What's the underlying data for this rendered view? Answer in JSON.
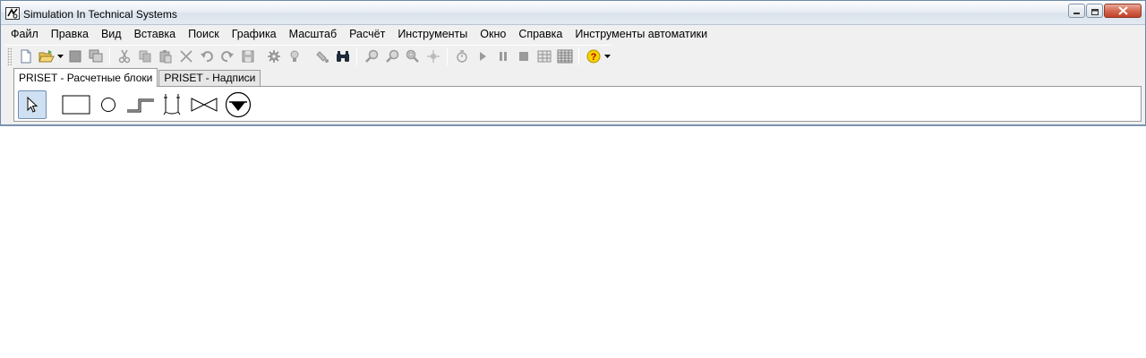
{
  "window": {
    "title": "Simulation In Technical Systems"
  },
  "menu": {
    "items": [
      {
        "label": "Файл"
      },
      {
        "label": "Правка"
      },
      {
        "label": "Вид"
      },
      {
        "label": "Вставка"
      },
      {
        "label": "Поиск"
      },
      {
        "label": "Графика"
      },
      {
        "label": "Масштаб"
      },
      {
        "label": "Расчёт"
      },
      {
        "label": "Инструменты"
      },
      {
        "label": "Окно"
      },
      {
        "label": "Справка"
      },
      {
        "label": "Инструменты автоматики"
      }
    ]
  },
  "toolbar": {
    "icons": [
      "new-file-icon",
      "open-folder-icon",
      "dropdown-arrow-icon",
      "stop-square-icon",
      "windows-icon",
      "cut-icon",
      "copy-icon",
      "paste-icon",
      "delete-icon",
      "undo-icon",
      "redo-icon",
      "save-icon",
      "gear-icon",
      "bulb-icon",
      "paint-icon",
      "binoculars-icon",
      "zoom-in-icon",
      "zoom-out-icon",
      "zoom-fit-icon",
      "crosshair-icon",
      "stopwatch-icon",
      "play-icon",
      "pause-icon",
      "stop-icon",
      "table-icon",
      "grid-icon",
      "help-icon",
      "dropdown-arrow-icon"
    ]
  },
  "tabs": [
    {
      "label": "PRISET - Расчетные блоки",
      "active": true
    },
    {
      "label": "PRISET - Надписи",
      "active": false
    }
  ],
  "palette": {
    "items": [
      "pointer-icon",
      "rectangle-block-icon",
      "circle-node-icon",
      "pipe-step-icon",
      "tank-icon",
      "valve-icon",
      "pump-icon"
    ],
    "selected": "pointer-icon"
  },
  "colors": {
    "window_border": "#6f8aa8",
    "close_button": "#c2402a",
    "selection": "#cfe0f2",
    "help_icon": "#e8c000"
  }
}
